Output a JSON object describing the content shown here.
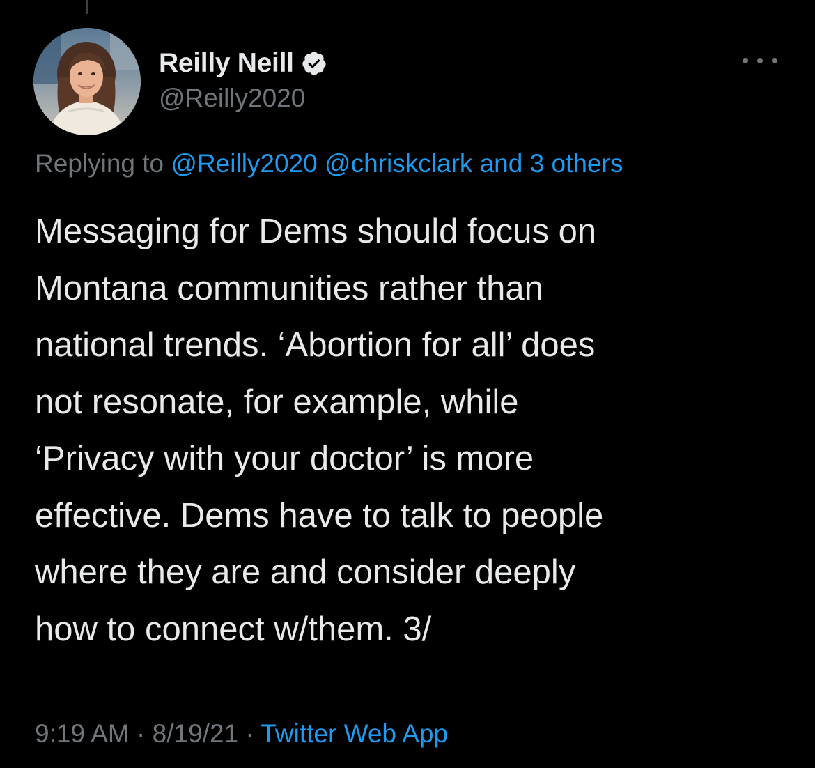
{
  "tweet": {
    "author": {
      "display_name": "Reilly Neill",
      "handle": "@Reilly2020",
      "verified": true,
      "avatar_icon": "avatar-photo"
    },
    "more_icon": "more-horizontal-icon",
    "reply_context": {
      "prefix": "Replying to",
      "mention_1": "@Reilly2020",
      "mention_2": "@chriskclark",
      "others": "and 3 others"
    },
    "text": "Messaging for Dems should focus on\nMontana communities rather than\nnational trends. ‘Abortion for all’ does\nnot resonate, for example, while\n‘Privacy with your doctor’ is more\neffective. Dems have to talk to people\nwhere they are and consider deeply\nhow to connect w/them. 3/",
    "time": "9:19 AM",
    "date": "8/19/21",
    "separator": "·",
    "source": "Twitter Web App"
  },
  "colors": {
    "background": "#000000",
    "text_primary": "#e7e9ea",
    "text_secondary": "#71767b",
    "accent": "#1d9bf0"
  }
}
